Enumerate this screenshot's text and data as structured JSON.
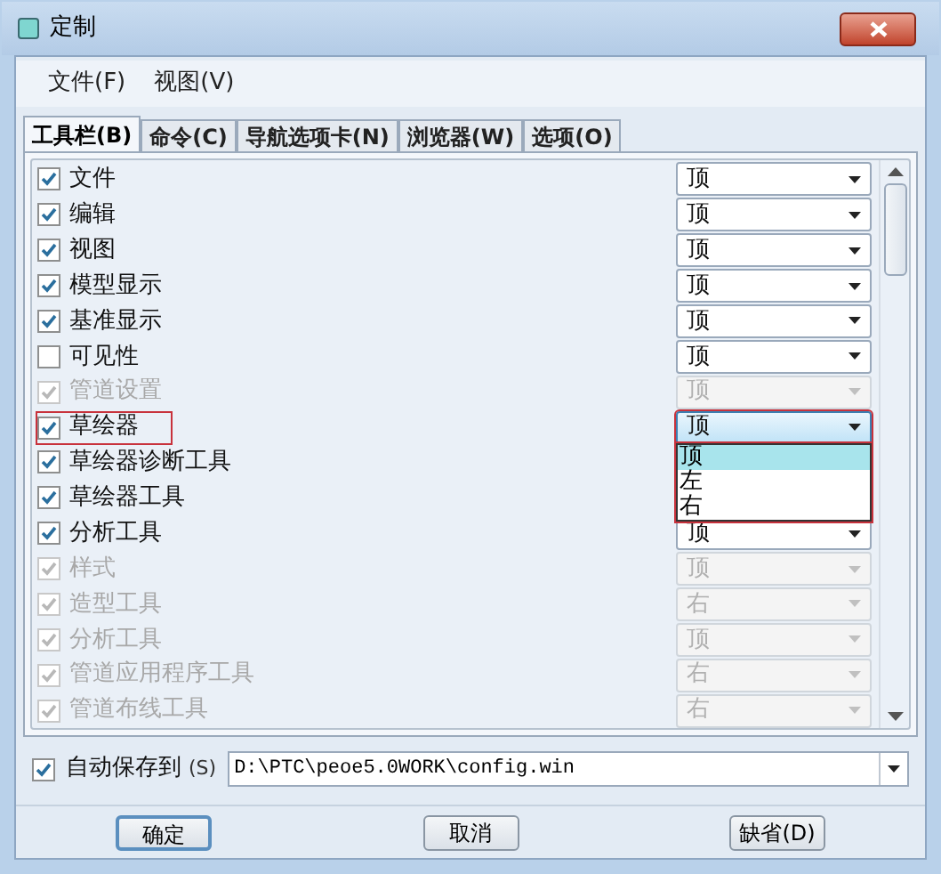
{
  "window": {
    "title": "定制"
  },
  "menu": [
    "文件(F)",
    "视图(V)"
  ],
  "tabs": [
    {
      "label": "工具栏(B)",
      "selected": true
    },
    {
      "label": "命令(C)",
      "selected": false
    },
    {
      "label": "导航选项卡(N)",
      "selected": false
    },
    {
      "label": "浏览器(W)",
      "selected": false
    },
    {
      "label": "选项(O)",
      "selected": false
    }
  ],
  "toolbars": [
    {
      "name": "文件",
      "checked": true,
      "disabled": false,
      "position": "顶"
    },
    {
      "name": "编辑",
      "checked": true,
      "disabled": false,
      "position": "顶"
    },
    {
      "name": "视图",
      "checked": true,
      "disabled": false,
      "position": "顶"
    },
    {
      "name": "模型显示",
      "checked": true,
      "disabled": false,
      "position": "顶"
    },
    {
      "name": "基准显示",
      "checked": true,
      "disabled": false,
      "position": "顶"
    },
    {
      "name": "可见性",
      "checked": false,
      "disabled": false,
      "position": "顶"
    },
    {
      "name": "管道设置",
      "checked": true,
      "disabled": true,
      "position": "顶"
    },
    {
      "name": "草绘器",
      "checked": true,
      "disabled": false,
      "position": "顶",
      "highlighted": true,
      "expanded": true,
      "options": [
        {
          "label": "顶",
          "selected": true
        },
        {
          "label": "左",
          "selected": false
        },
        {
          "label": "右",
          "selected": false
        }
      ]
    },
    {
      "name": "草绘器诊断工具",
      "checked": true,
      "disabled": false
    },
    {
      "name": "草绘器工具",
      "checked": true,
      "disabled": false
    },
    {
      "name": "分析工具",
      "checked": true,
      "disabled": false,
      "position": "顶"
    },
    {
      "name": "样式",
      "checked": true,
      "disabled": true,
      "position": "顶"
    },
    {
      "name": "造型工具",
      "checked": true,
      "disabled": true,
      "position": "右"
    },
    {
      "name": "分析工具",
      "checked": true,
      "disabled": true,
      "position": "顶"
    },
    {
      "name": "管道应用程序工具",
      "checked": true,
      "disabled": true,
      "position": "右"
    },
    {
      "name": "管道布线工具",
      "checked": true,
      "disabled": true,
      "position": "右"
    }
  ],
  "autosave": {
    "label": "自动保存到",
    "shortcut": "(S)",
    "checked": true,
    "value": "D:\\PTC\\peoe5.0WORK\\config.win"
  },
  "buttons": [
    "确定",
    "取消",
    "缺省(D)"
  ]
}
